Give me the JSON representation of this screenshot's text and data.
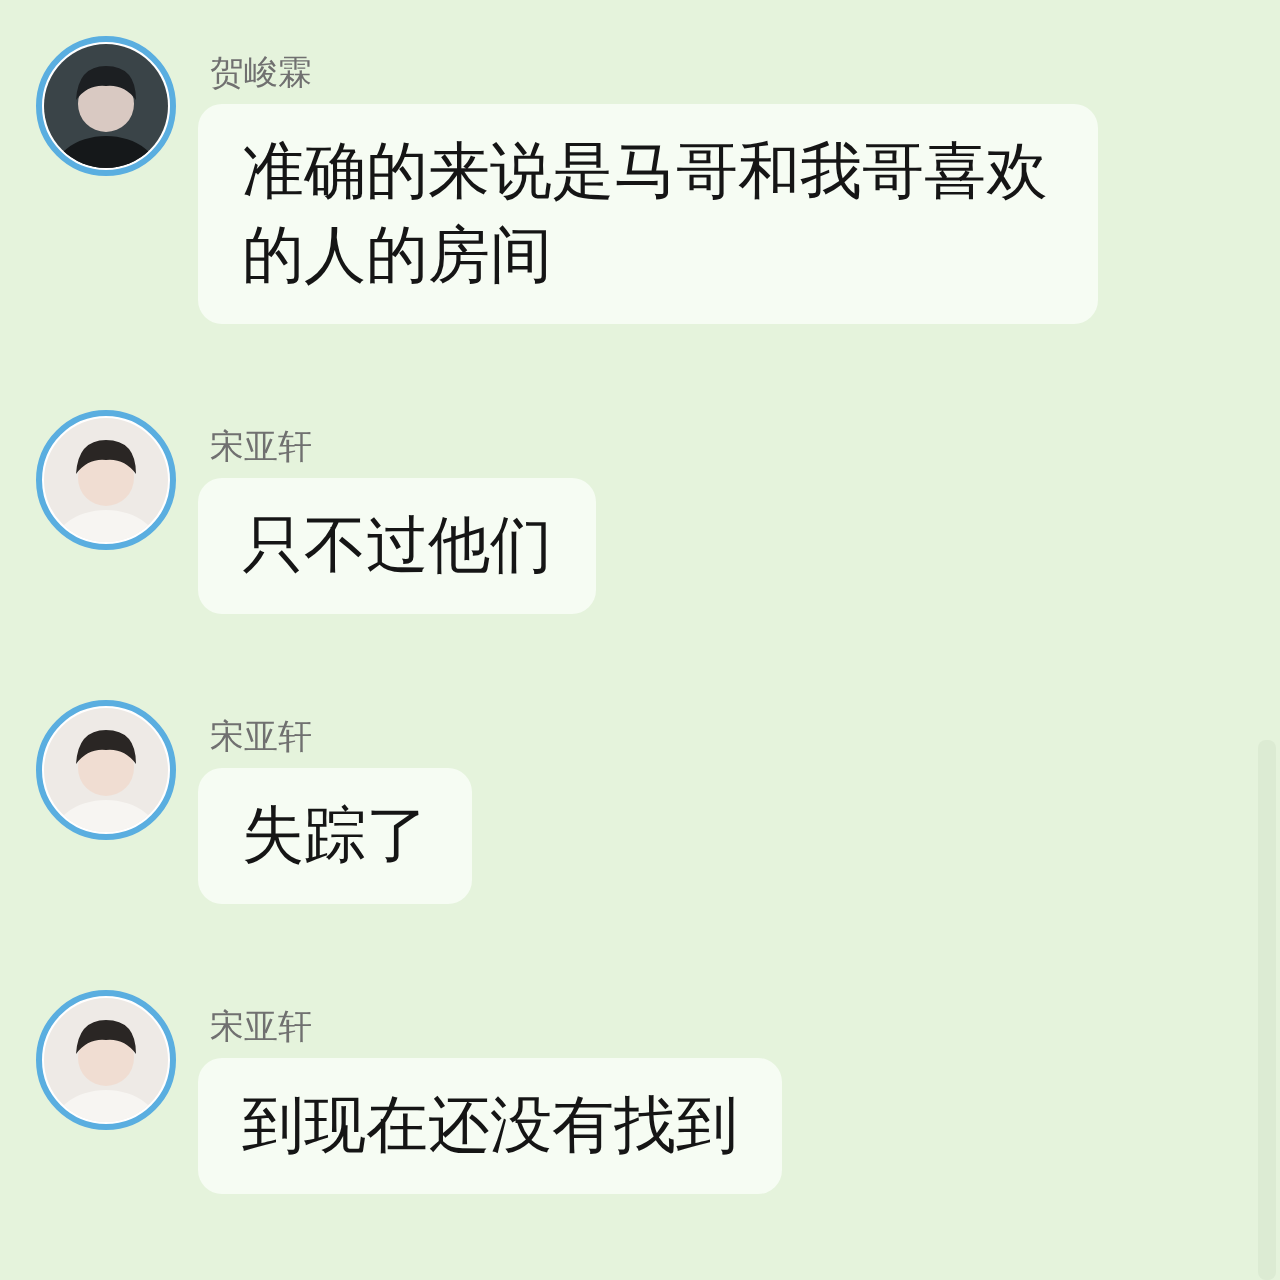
{
  "messages": [
    {
      "sender": "贺峻霖",
      "kind": "dark",
      "text": "准确的来说是马哥和我哥喜欢的人的房间"
    },
    {
      "sender": "宋亚轩",
      "kind": "light",
      "text": "只不过他们"
    },
    {
      "sender": "宋亚轩",
      "kind": "light",
      "text": "失踪了"
    },
    {
      "sender": "宋亚轩",
      "kind": "light",
      "text": "到现在还没有找到"
    }
  ]
}
